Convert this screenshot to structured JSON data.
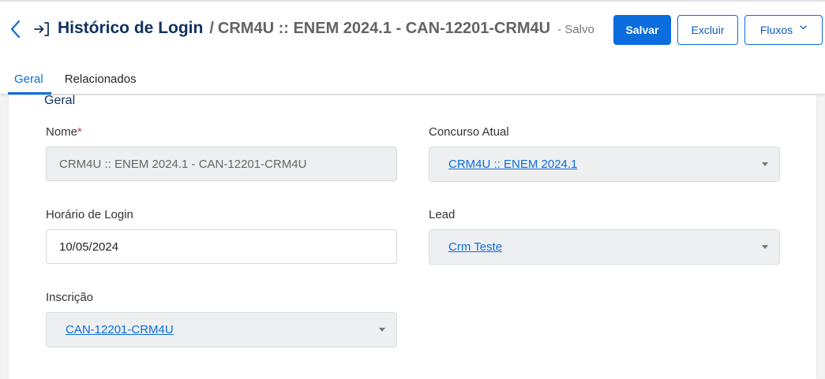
{
  "header": {
    "back_icon": "chevron-left-icon",
    "entity_icon": "sign-in-icon",
    "entity_title": "Histórico de Login",
    "separator": "/",
    "record_name": "CRM4U :: ENEM 2024.1 - CAN-12201-CRM4U",
    "status": "- Salvo",
    "buttons": {
      "save": "Salvar",
      "delete": "Excluir",
      "flows": "Fluxos",
      "flows_icon": "chevron-down-icon"
    }
  },
  "tabs": [
    {
      "label": "Geral",
      "active": true
    },
    {
      "label": "Relacionados",
      "active": false
    }
  ],
  "section": {
    "title": "Geral",
    "fields": {
      "nome": {
        "label": "Nome",
        "required_mark": "*",
        "value": "CRM4U :: ENEM 2024.1 - CAN-12201-CRM4U"
      },
      "concurso_atual": {
        "label": "Concurso Atual",
        "value": "CRM4U :: ENEM 2024.1"
      },
      "horario_login": {
        "label": "Horário de Login",
        "value": "10/05/2024"
      },
      "lead": {
        "label": "Lead",
        "value": "Crm Teste"
      },
      "inscricao": {
        "label": "Inscrição",
        "value": "CAN-12201-CRM4U"
      }
    }
  },
  "colors": {
    "primary": "#0b6dde",
    "title": "#10315f",
    "required": "#d13438"
  }
}
